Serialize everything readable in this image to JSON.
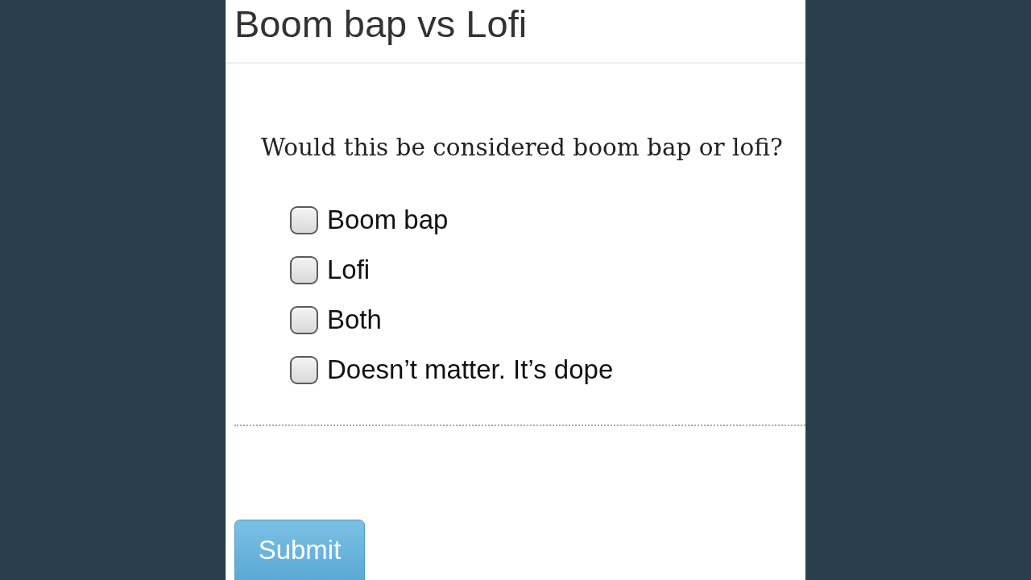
{
  "page": {
    "title": "Boom bap vs Lofi"
  },
  "question": {
    "text": "Would this be considered boom bap or lofi?",
    "options": [
      {
        "label": "Boom bap",
        "checked": false
      },
      {
        "label": "Lofi",
        "checked": false
      },
      {
        "label": "Both",
        "checked": false
      },
      {
        "label": "Doesn’t matter. It’s dope",
        "checked": false
      }
    ]
  },
  "submit_button": {
    "label": "Submit"
  }
}
